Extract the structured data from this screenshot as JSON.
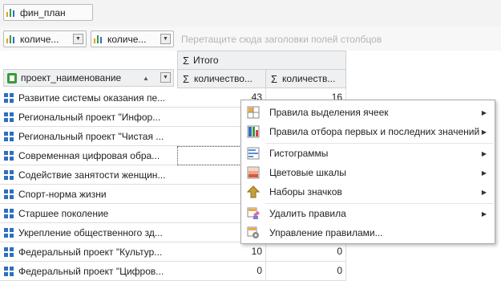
{
  "filter_bar": {
    "chip_label": "фин_план"
  },
  "column_area": {
    "field_chips": [
      {
        "label": "количе..."
      },
      {
        "label": "количе..."
      }
    ],
    "drop_hint": "Перетащите сюда заголовки полей столбцов"
  },
  "grid": {
    "total_header": "Итого",
    "sigma": "Σ",
    "row_field": "проект_наименование",
    "sort_glyph": "▲",
    "columns": [
      "количество...",
      "количеств..."
    ],
    "rows": [
      {
        "name": "Развитие системы оказания пе...",
        "v1": "43",
        "v2": "16"
      },
      {
        "name": "Региональный проект \"Инфор...",
        "v1": "",
        "v2": ""
      },
      {
        "name": "Региональный проект \"Чистая ...",
        "v1": "",
        "v2": ""
      },
      {
        "name": "Современная цифровая обра...",
        "v1": "",
        "v2": ""
      },
      {
        "name": "Содействие занятости женщин...",
        "v1": "",
        "v2": ""
      },
      {
        "name": "Спорт-норма жизни",
        "v1": "",
        "v2": ""
      },
      {
        "name": "Старшее поколение",
        "v1": "",
        "v2": ""
      },
      {
        "name": "Укрепление общественного зд...",
        "v1": "",
        "v2": ""
      },
      {
        "name": "Федеральный проект \"Культур...",
        "v1": "10",
        "v2": "0"
      },
      {
        "name": "Федеральный проект \"Цифров...",
        "v1": "0",
        "v2": "0"
      }
    ]
  },
  "context_menu": {
    "items": [
      {
        "label": "Правила выделения ячеек",
        "icon": "highlight-rules-icon",
        "submenu": true
      },
      {
        "label": "Правила отбора первых и последних значений",
        "icon": "top-bottom-rules-icon",
        "submenu": true
      },
      {
        "label": "Гистограммы",
        "icon": "data-bars-icon",
        "submenu": true
      },
      {
        "label": "Цветовые шкалы",
        "icon": "color-scales-icon",
        "submenu": true
      },
      {
        "label": "Наборы значков",
        "icon": "icon-sets-icon",
        "submenu": true
      },
      {
        "label": "Удалить правила",
        "icon": "clear-rules-icon",
        "submenu": true
      },
      {
        "label": "Управление правилами...",
        "icon": "manage-rules-icon",
        "submenu": false
      }
    ],
    "submenu_arrow": "▶"
  },
  "colors": {
    "accent_blue": "#2d6fc0",
    "header_bg": "#eef0f2",
    "menu_border": "#a8a8a8"
  }
}
